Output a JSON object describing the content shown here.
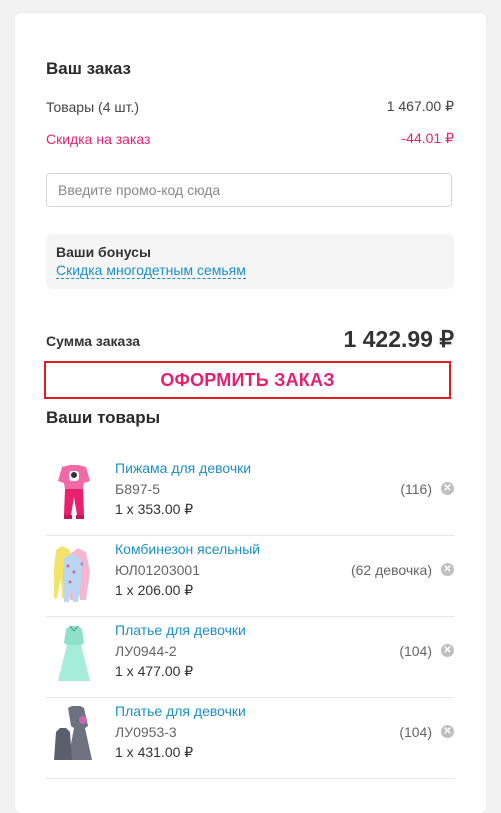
{
  "order": {
    "title": "Ваш заказ",
    "goods_label": "Товары (4 шт.)",
    "goods_value": "1 467.00 ₽",
    "discount_label": "Скидка на заказ",
    "discount_value": "-44.01 ₽",
    "promo_placeholder": "Введите промо-код сюда",
    "bonus_title": "Ваши бонусы",
    "bonus_link": "Скидка многодетным семьям",
    "sum_label": "Сумма заказа",
    "sum_value": "1 422.99 ₽",
    "checkout_label": "ОФОРМИТЬ ЗАКАЗ"
  },
  "items_section": {
    "title": "Ваши товары",
    "items": [
      {
        "name": "Пижама для девочки",
        "sku": "Б897-5",
        "size": "(116)",
        "price": "1 x 353.00 ₽",
        "thumb": "pajama"
      },
      {
        "name": "Комбинезон ясельный",
        "sku": "ЮЛ01203001",
        "size": "(62 девочка)",
        "price": "1 x 206.00 ₽",
        "thumb": "romper"
      },
      {
        "name": "Платье для девочки",
        "sku": "ЛУ0944-2",
        "size": "(104)",
        "price": "1 x 477.00 ₽",
        "thumb": "dress-mint"
      },
      {
        "name": "Платье для девочки",
        "sku": "ЛУ0953-3",
        "size": "(104)",
        "price": "1 x 431.00 ₽",
        "thumb": "dress-grey"
      }
    ]
  },
  "colors": {
    "accent_pink": "#e5206f",
    "link_blue": "#1a8fc6",
    "checkout_border": "#e31b23"
  }
}
